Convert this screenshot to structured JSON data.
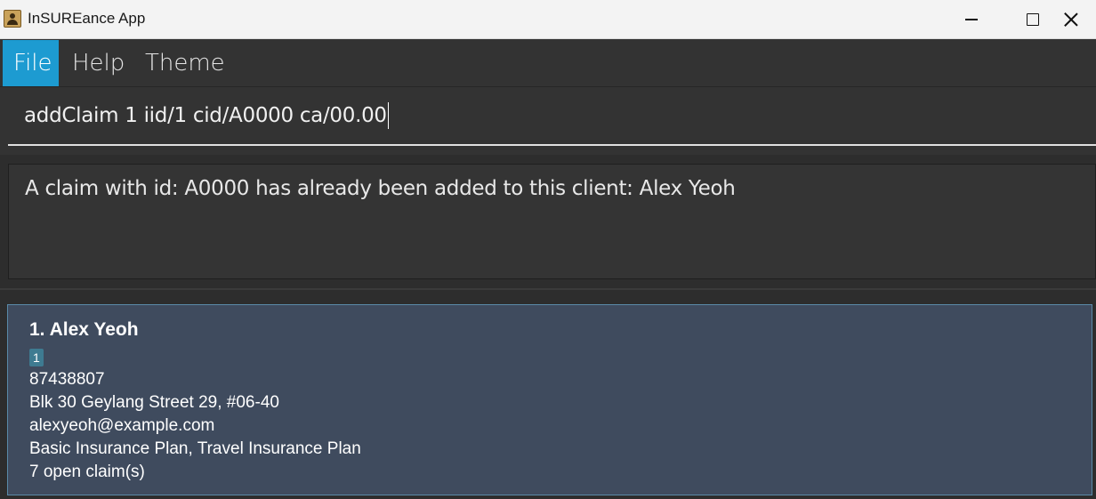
{
  "window": {
    "title": "InSUREance App",
    "icon": "contacts-book-icon"
  },
  "menu": {
    "items": [
      {
        "label": "File",
        "active": true
      },
      {
        "label": "Help",
        "active": false
      },
      {
        "label": "Theme",
        "active": false
      }
    ]
  },
  "command": {
    "value": "addClaim 1 iid/1 cid/A0000 ca/00.00"
  },
  "result": {
    "message": "A claim with id: A0000 has already been added to this client: Alex Yeoh"
  },
  "clients": [
    {
      "index_name": "1. Alex Yeoh",
      "tag": "1",
      "phone": "87438807",
      "address": "Blk 30 Geylang Street 29, #06-40",
      "email": "alexyeoh@example.com",
      "insurance": "Basic Insurance Plan, Travel Insurance Plan",
      "claims": "7 open claim(s)"
    }
  ],
  "colors": {
    "accent": "#1d9bd1",
    "card_bg": "#3f4b5e",
    "tag_bg": "#3e7b91"
  }
}
